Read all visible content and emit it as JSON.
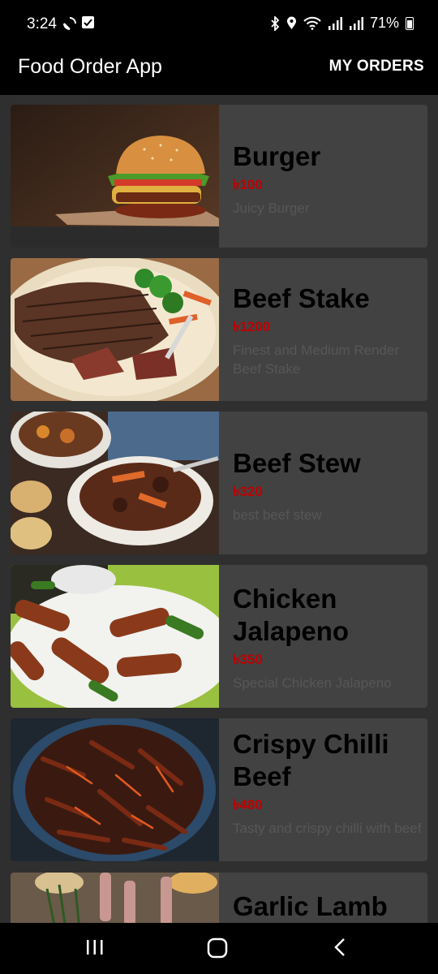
{
  "status_bar": {
    "time": "3:24",
    "battery": "71%"
  },
  "app_bar": {
    "title": "Food Order App",
    "my_orders": "MY ORDERS"
  },
  "menu": [
    {
      "name": "Burger",
      "price": "৳100",
      "description": "Juicy Burger",
      "image": "burger-image"
    },
    {
      "name": "Beef Stake",
      "price": "৳1200",
      "description": "Finest and Medium Render Beef Stake",
      "image": "steak-image"
    },
    {
      "name": "Beef Stew",
      "price": "৳320",
      "description": "best beef stew",
      "image": "stew-image"
    },
    {
      "name": "Chicken Jalapeno",
      "price": "৳350",
      "description": "Special Chicken Jalapeno",
      "image": "jalapeno-image"
    },
    {
      "name": "Crispy Chilli Beef",
      "price": "৳480",
      "description": "Tasty and crispy chilli with beef",
      "image": "chilli-beef-image"
    },
    {
      "name": "Garlic Lamb",
      "price": "",
      "description": "",
      "image": "lamb-image"
    }
  ],
  "colors": {
    "app_bar": "#000000",
    "card": "#424242",
    "price": "#c00000",
    "description": "#575757"
  }
}
